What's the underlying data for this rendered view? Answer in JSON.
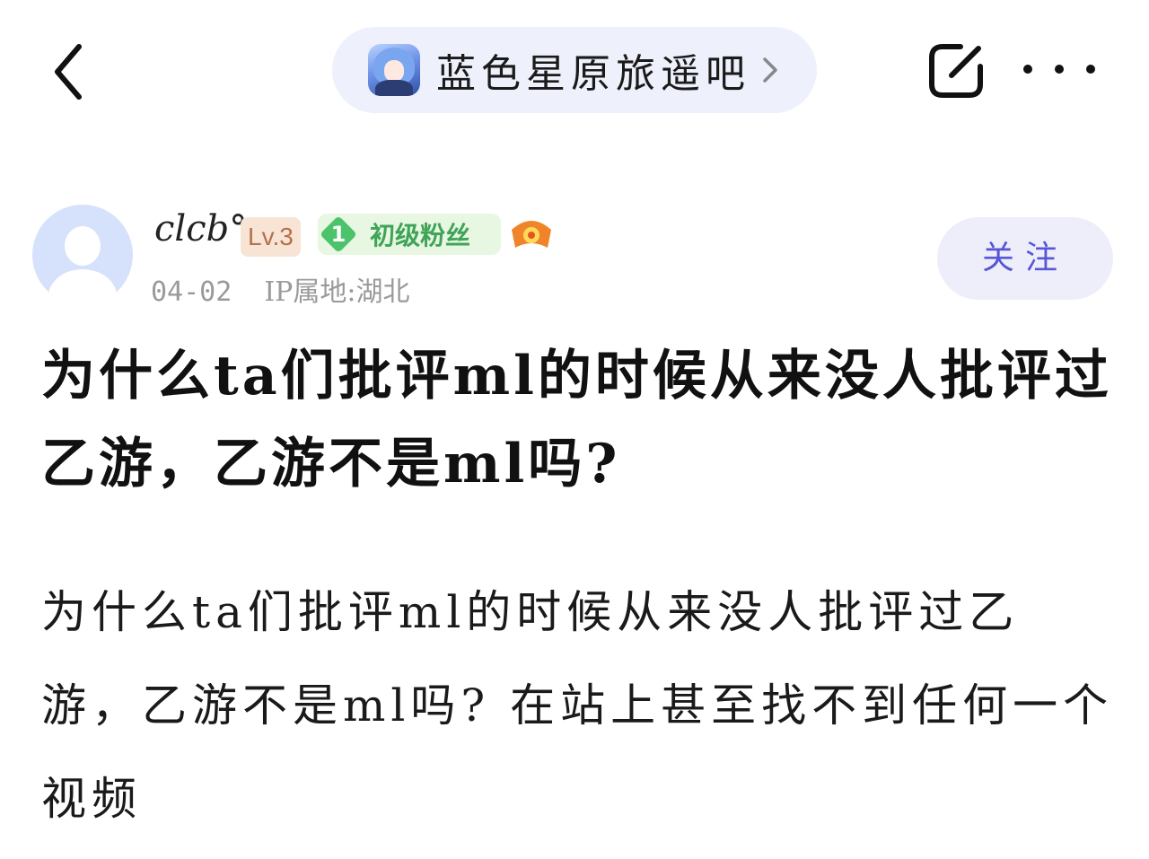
{
  "header": {
    "forum_name": "蓝色星原旅遥吧"
  },
  "author": {
    "username": "clcb°",
    "level": "Lv.3",
    "fan_level_num": "1",
    "fan_level_label": "初级粉丝",
    "date": "04-02",
    "ip_location": "IP属地:湖北",
    "follow_label": "关注"
  },
  "post": {
    "title": "为什么ta们批评ml的时候从来没人批评过乙游，乙游不是ml吗?",
    "body": "为什么ta们批评ml的时候从来没人批评过乙游，乙游不是ml吗? 在站上甚至找不到任何一个视频"
  }
}
